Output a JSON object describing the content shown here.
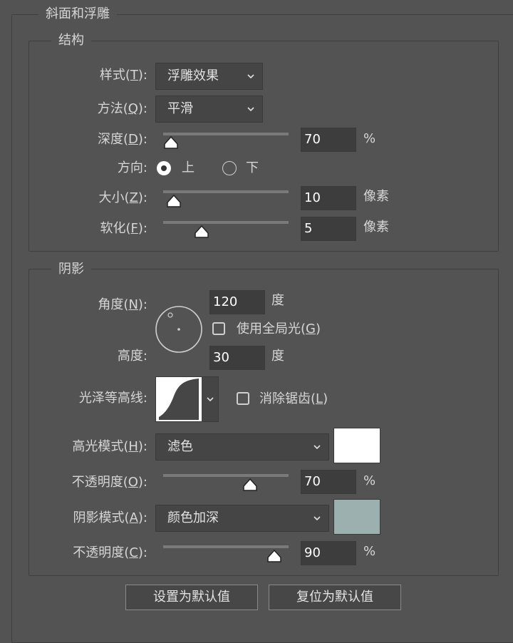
{
  "section_title": "斜面和浮雕",
  "structure": {
    "title": "结构",
    "style_label": "样式(",
    "style_key": "T",
    "style_value": "浮雕效果",
    "method_label": "方法(",
    "method_key": "Q",
    "method_value": "平滑",
    "depth_label": "深度(",
    "depth_key": "D",
    "depth_value": "70",
    "depth_unit": "%",
    "direction_label": "方向:",
    "direction_up": "上",
    "direction_down": "下",
    "size_label": "大小(",
    "size_key": "Z",
    "size_value": "10",
    "size_unit": "像素",
    "soften_label": "软化(",
    "soften_key": "F",
    "soften_value": "5",
    "soften_unit": "像素",
    "label_suffix": "):"
  },
  "shadow": {
    "title": "阴影",
    "angle_label": "角度(",
    "angle_key": "N",
    "angle_value": "120",
    "angle_unit": "度",
    "global_light_label": "使用全局光(",
    "global_light_key": "G",
    "altitude_label": "高度:",
    "altitude_value": "30",
    "altitude_unit": "度",
    "gloss_contour_label": "光泽等高线:",
    "anti_alias_label": "消除锯齿(",
    "anti_alias_key": "L",
    "highlight_mode_label": "高光模式(",
    "highlight_mode_key": "H",
    "highlight_mode_value": "滤色",
    "highlight_color": "#ffffff",
    "highlight_opacity_label": "不透明度(",
    "highlight_opacity_key": "O",
    "highlight_opacity_value": "70",
    "highlight_opacity_unit": "%",
    "shadow_mode_label": "阴影模式(",
    "shadow_mode_key": "A",
    "shadow_mode_value": "颜色加深",
    "shadow_color": "#9cb0b0",
    "shadow_opacity_label": "不透明度(",
    "shadow_opacity_key": "C",
    "shadow_opacity_value": "90",
    "shadow_opacity_unit": "%"
  },
  "buttons": {
    "make_default": "设置为默认值",
    "reset_default": "复位为默认值"
  },
  "close_paren": ")"
}
